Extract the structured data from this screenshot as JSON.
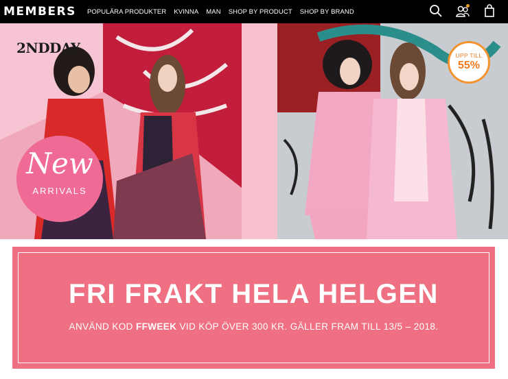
{
  "header": {
    "logo": "MEMBERS",
    "nav": [
      "POPULÄRA PRODUKTER",
      "KVINNA",
      "MAN",
      "SHOP BY PRODUCT",
      "SHOP BY BRAND"
    ],
    "icons": [
      "search-icon",
      "account-icon",
      "shopping-bag-icon"
    ]
  },
  "hero": {
    "brand_logo": "2NDDAY",
    "new_badge": {
      "script": "New",
      "arrivals": "ARRIVALS"
    },
    "sale_badge": {
      "line1": "UPP TILL",
      "line2": "55%"
    }
  },
  "promo": {
    "title": "FRI FRAKT HELA HELGEN",
    "sub_before": "ANVÄND KOD ",
    "code": "FFWEEK",
    "sub_after": " VID KÖP ÖVER 300 KR. GÄLLER FRAM TILL 13/5 – 2018."
  },
  "colors": {
    "topbar": "#000000",
    "accent_pink": "#ee7082",
    "badge_pink": "#ef6b96",
    "sale_orange": "#f4922e"
  }
}
